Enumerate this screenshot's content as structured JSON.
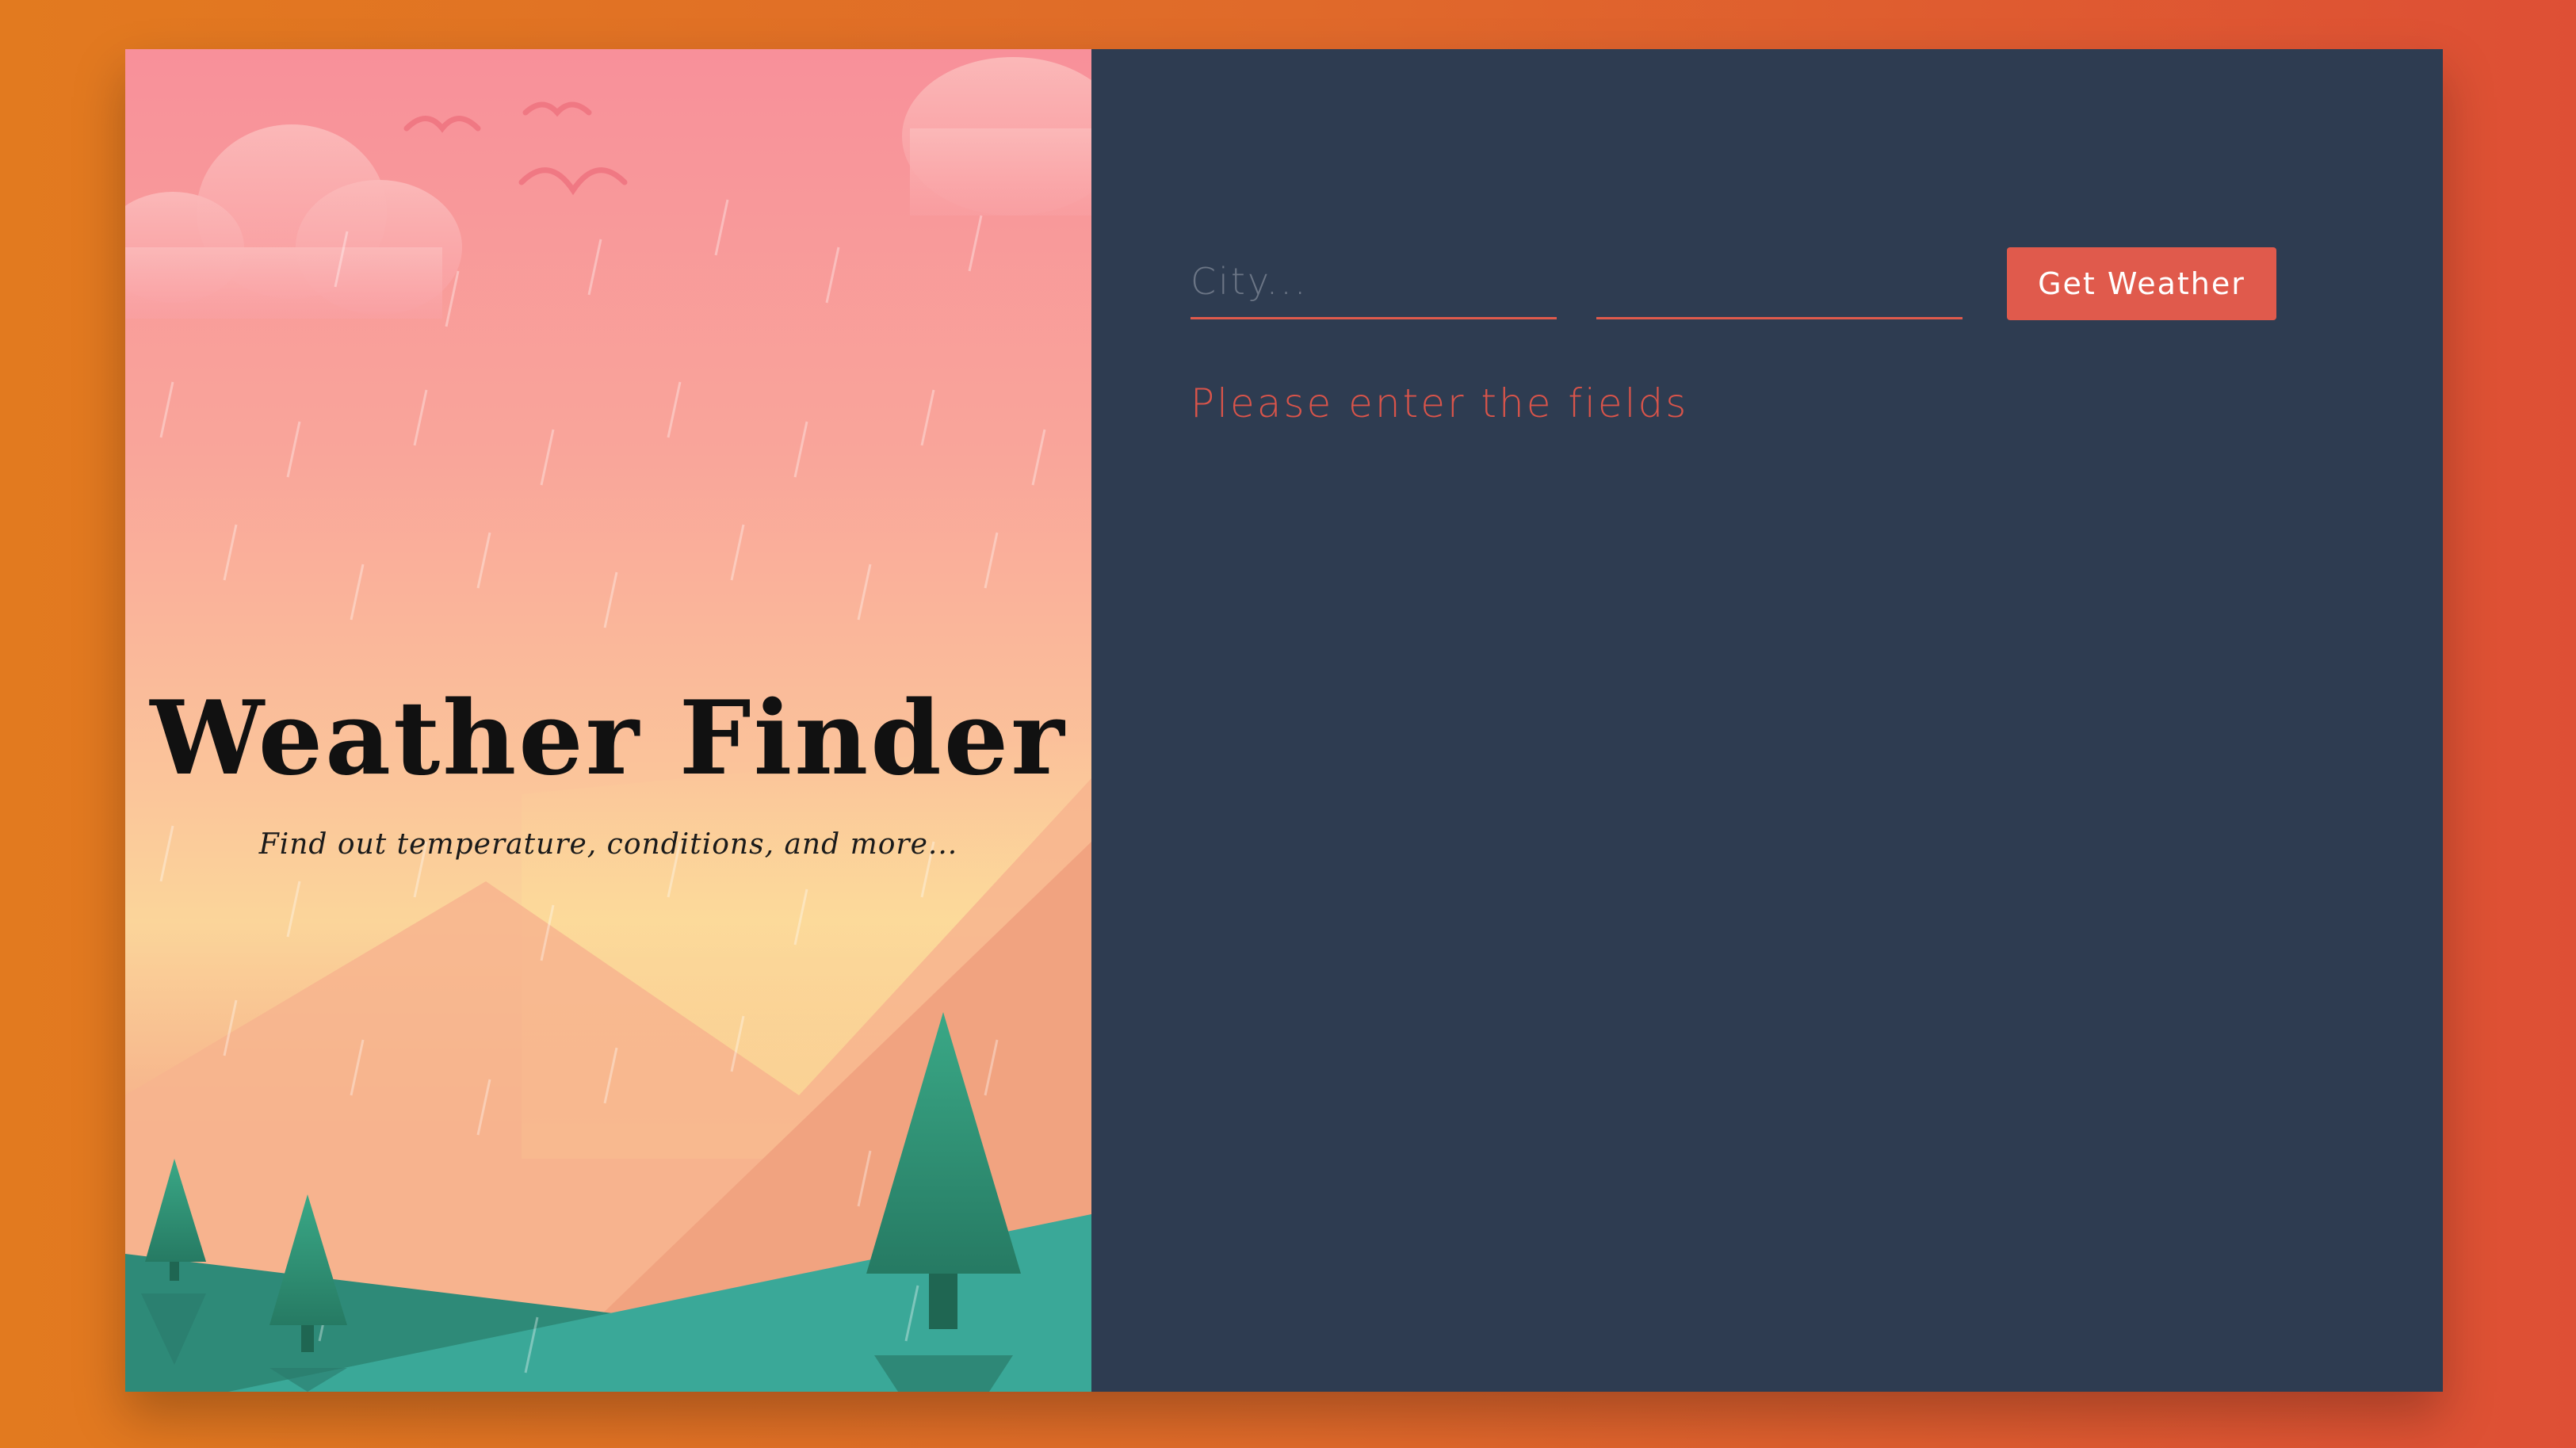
{
  "hero": {
    "title": "Weather Finder",
    "subtitle": "Find out temperature, conditions, and more..."
  },
  "form": {
    "city_placeholder": "City...",
    "country_placeholder": "",
    "city_value": "",
    "country_value": "",
    "submit_label": "Get Weather"
  },
  "status": {
    "error_message": "Please enter the fields"
  },
  "colors": {
    "accent": "#e05a4c",
    "panel_background": "#2e3c51",
    "page_gradient_start": "#e27a1f",
    "page_gradient_end": "#de4f35"
  }
}
